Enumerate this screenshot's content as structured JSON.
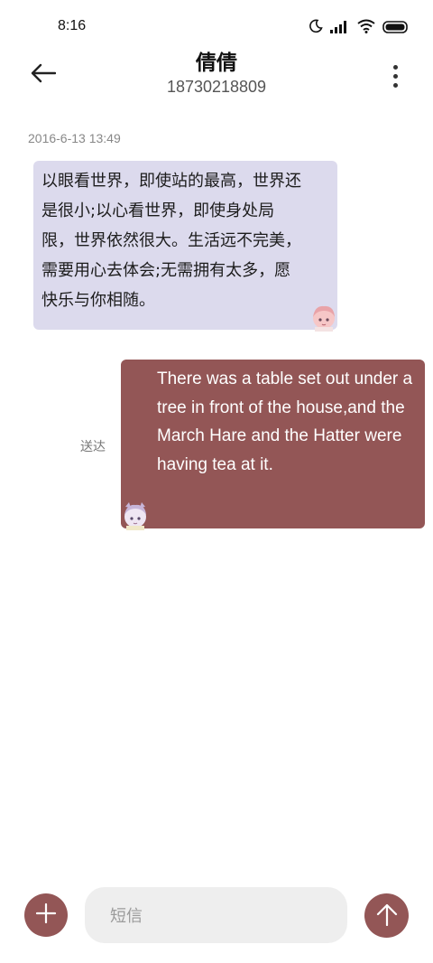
{
  "status_bar": {
    "time": "8:16",
    "icons": [
      "moon-icon",
      "signal-icon",
      "wifi-icon",
      "battery-icon"
    ]
  },
  "header": {
    "contact_name": "倩倩",
    "contact_number": "18730218809",
    "back_icon": "back-arrow-icon",
    "menu_icon": "more-vertical-icon"
  },
  "conversation": {
    "timestamp": "2016-6-13 13:49",
    "messages": [
      {
        "direction": "incoming",
        "text": "以眼看世界，即使站的最高，世界还是很小;以心看世界，即使身处局限，世界依然很大。生活远不完美，需要用心去体会;无需拥有太多，愿快乐与你相随。"
      },
      {
        "direction": "outgoing",
        "text": "There was a table set out under a tree in front of the house,and the March Hare and the Hatter were having tea at it.",
        "status": "送达"
      }
    ]
  },
  "composer": {
    "placeholder": "短信",
    "add_icon": "plus-icon",
    "send_icon": "arrow-up-icon"
  },
  "colors": {
    "accent": "#935656",
    "incoming_bubble": "#dcdaed",
    "input_background": "#eeeeee"
  }
}
